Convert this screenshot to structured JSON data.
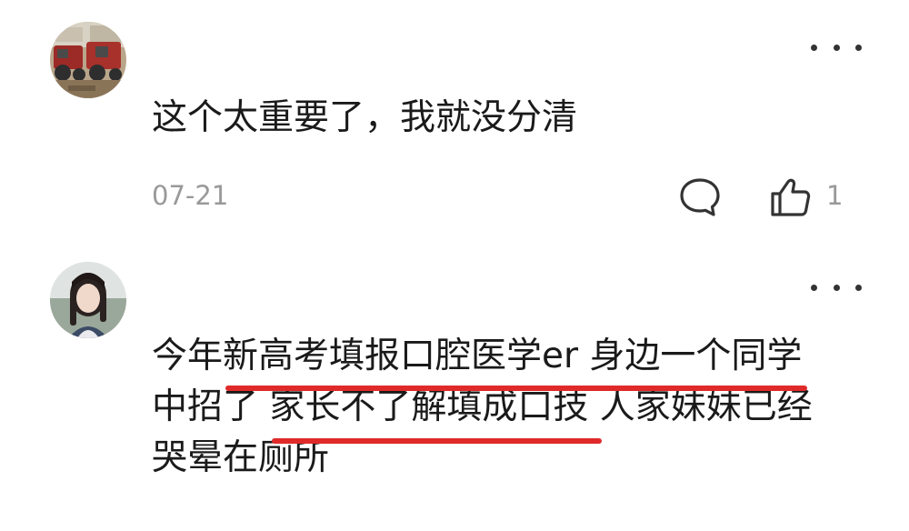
{
  "comments": [
    {
      "avatar_icon": "user-avatar-farm-icon",
      "text": "这个太重要了，我就没分清",
      "date": "07-21",
      "reply_icon": "comment-bubble-icon",
      "like_icon": "thumbs-up-icon",
      "like_count": "1",
      "more_icon": "more-dots-icon"
    },
    {
      "avatar_icon": "user-avatar-girl-icon",
      "text_lines": [
        "今年新高考填报口腔医学er 身边一个同学",
        "中招了 家长不了解填成口技 人家妹妹已经",
        "哭晕在厕所"
      ],
      "more_icon": "more-dots-icon"
    }
  ],
  "colors": {
    "text": "#1a1a1a",
    "meta": "#999999",
    "underline": "#e02a2a"
  }
}
